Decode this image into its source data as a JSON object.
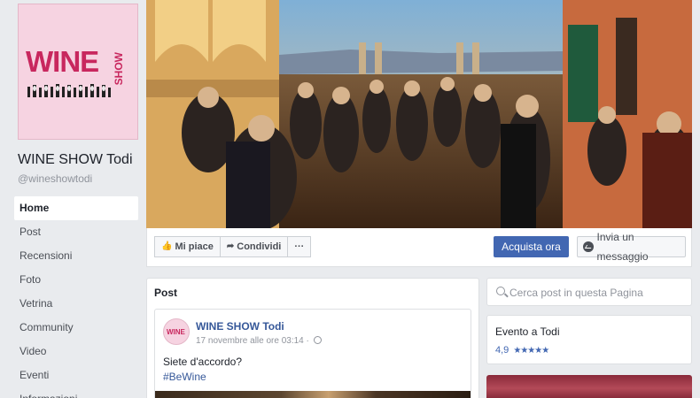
{
  "page": {
    "name": "WINE SHOW Todi",
    "handle": "@wineshowtodi",
    "logo_text": "WINE",
    "logo_sub": "SHOW"
  },
  "nav": {
    "items": [
      {
        "label": "Home",
        "active": true
      },
      {
        "label": "Post",
        "active": false
      },
      {
        "label": "Recensioni",
        "active": false
      },
      {
        "label": "Foto",
        "active": false
      },
      {
        "label": "Vetrina",
        "active": false
      },
      {
        "label": "Community",
        "active": false
      },
      {
        "label": "Video",
        "active": false
      },
      {
        "label": "Eventi",
        "active": false
      },
      {
        "label": "Informazioni",
        "active": false
      }
    ]
  },
  "actions": {
    "like": "Mi piace",
    "share": "Condividi",
    "more": "···",
    "buy": "Acquista ora",
    "message": "Invia un messaggio"
  },
  "posts": {
    "section_title": "Post",
    "author": "WINE SHOW Todi",
    "time": "17 novembre alle ore 03:14 ·",
    "text": "Siete d'accordo?",
    "hashtag": "#BeWine",
    "avatar_text": "WINE"
  },
  "sidebar": {
    "search_placeholder": "Cerca post in questa Pagina",
    "event_title": "Evento a Todi",
    "rating_value": "4,9",
    "rating_stars": "★★★★★"
  },
  "colors": {
    "accent": "#4267b2",
    "brand_pink": "#c8275e",
    "link": "#365899",
    "background": "#e9ebee"
  }
}
